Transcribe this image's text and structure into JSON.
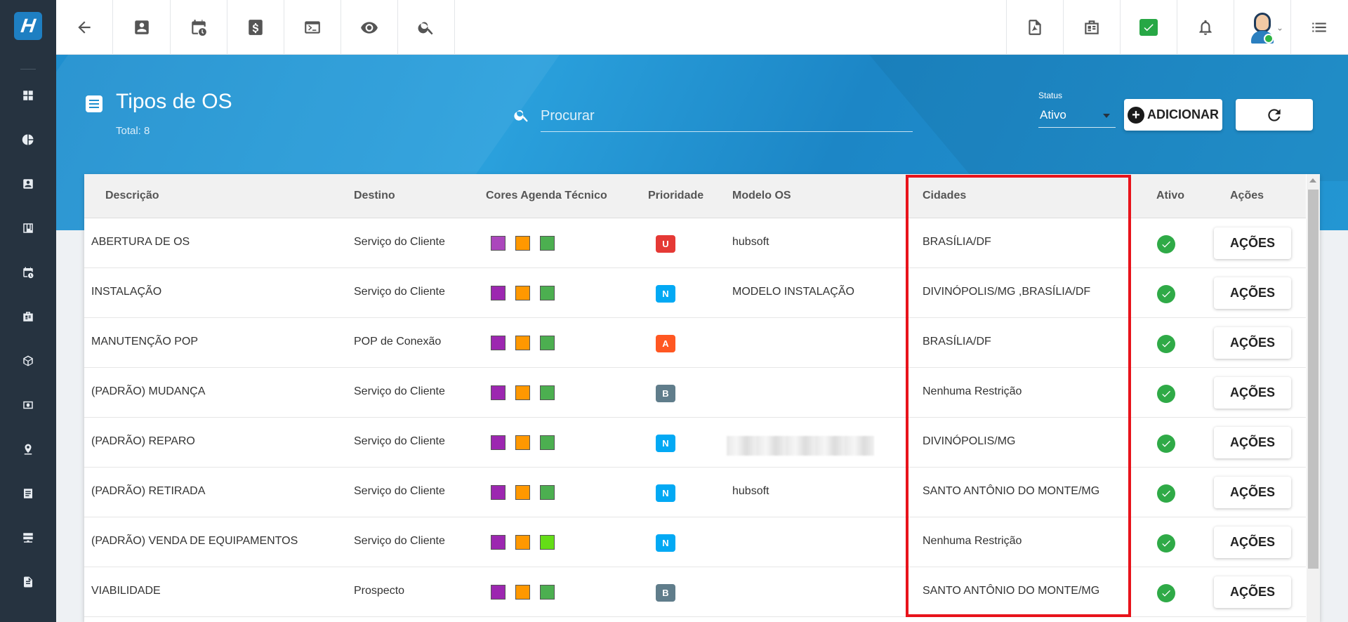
{
  "app": {
    "name": "hubsoft"
  },
  "sidebar": {
    "items": [
      {
        "icon": "dashboard-icon"
      },
      {
        "icon": "pie-chart-icon"
      },
      {
        "icon": "contact-card-icon"
      },
      {
        "icon": "kanban-icon"
      },
      {
        "icon": "calendar-clock-icon"
      },
      {
        "icon": "building-icon"
      },
      {
        "icon": "cube-icon"
      },
      {
        "icon": "money-icon"
      },
      {
        "icon": "map-pin-icon"
      },
      {
        "icon": "list-icon"
      },
      {
        "icon": "server-icon"
      },
      {
        "icon": "document-icon"
      },
      {
        "icon": "gear-icon"
      }
    ]
  },
  "topbar": {
    "left_icons": [
      "back-arrow-icon",
      "contact-icon",
      "calendar-clock-icon",
      "dollar-icon",
      "terminal-icon",
      "eye-icon",
      "search-icon"
    ],
    "right_icons": [
      "pdf-icon",
      "building-icon",
      "check-message-icon",
      "bell-icon",
      "avatar",
      "menu-icon"
    ]
  },
  "header": {
    "title": "Tipos de OS",
    "total": "Total: 8",
    "search_placeholder": "Procurar",
    "status_label": "Status",
    "status_value": "Ativo",
    "add_label": "ADICIONAR"
  },
  "table": {
    "columns": [
      "Descrição",
      "Destino",
      "Cores Agenda Técnico",
      "Prioridade",
      "Modelo OS",
      "Cidades",
      "Ativo",
      "Ações"
    ],
    "action_label": "AÇÕES",
    "rows": [
      {
        "descricao": "ABERTURA DE OS",
        "destino": "Serviço do Cliente",
        "cores": [
          "#ab47bc",
          "#ff9800",
          "#4caf50"
        ],
        "prioridade": "U",
        "prioridade_color": "#e53935",
        "modelo": "hubsoft",
        "cidades": "BRASÍLIA/DF",
        "ativo": true
      },
      {
        "descricao": "INSTALAÇÃO",
        "destino": "Serviço do Cliente",
        "cores": [
          "#9c27b0",
          "#ff9800",
          "#4caf50"
        ],
        "prioridade": "N",
        "prioridade_color": "#03a9f4",
        "modelo": "MODELO INSTALAÇÃO",
        "cidades": "DIVINÓPOLIS/MG ,BRASÍLIA/DF",
        "ativo": true
      },
      {
        "descricao": "MANUTENÇÃO POP",
        "destino": "POP de Conexão",
        "cores": [
          "#9c27b0",
          "#ff9800",
          "#4caf50"
        ],
        "prioridade": "A",
        "prioridade_color": "#ff5722",
        "modelo": "",
        "cidades": "BRASÍLIA/DF",
        "ativo": true
      },
      {
        "descricao": "(PADRÃO) MUDANÇA",
        "destino": "Serviço do Cliente",
        "cores": [
          "#9c27b0",
          "#ff9800",
          "#4caf50"
        ],
        "prioridade": "B",
        "prioridade_color": "#607d8b",
        "modelo": "",
        "cidades": "Nenhuma Restrição",
        "ativo": true
      },
      {
        "descricao": "(PADRÃO) REPARO",
        "destino": "Serviço do Cliente",
        "cores": [
          "#9c27b0",
          "#ff9800",
          "#4caf50"
        ],
        "prioridade": "N",
        "prioridade_color": "#03a9f4",
        "modelo": "",
        "modelo_blurred": true,
        "cidades": "DIVINÓPOLIS/MG",
        "ativo": true
      },
      {
        "descricao": "(PADRÃO) RETIRADA",
        "destino": "Serviço do Cliente",
        "cores": [
          "#9c27b0",
          "#ff9800",
          "#4caf50"
        ],
        "prioridade": "N",
        "prioridade_color": "#03a9f4",
        "modelo": "hubsoft",
        "cidades": "SANTO ANTÔNIO DO MONTE/MG",
        "ativo": true
      },
      {
        "descricao": "(PADRÃO) VENDA DE EQUIPAMENTOS",
        "destino": "Serviço do Cliente",
        "cores": [
          "#9c27b0",
          "#ff9800",
          "#64dd17"
        ],
        "prioridade": "N",
        "prioridade_color": "#03a9f4",
        "modelo": "",
        "cidades": "Nenhuma Restrição",
        "ativo": true
      },
      {
        "descricao": "VIABILIDADE",
        "destino": "Prospecto",
        "cores": [
          "#9c27b0",
          "#ff9800",
          "#4caf50"
        ],
        "prioridade": "B",
        "prioridade_color": "#607d8b",
        "modelo": "",
        "cidades": "SANTO ANTÔNIO DO MONTE/MG",
        "ativo": true
      }
    ]
  },
  "colors": {
    "accent": "#1f8fcf",
    "sidebar": "#263340",
    "highlight": "#e8131b"
  }
}
